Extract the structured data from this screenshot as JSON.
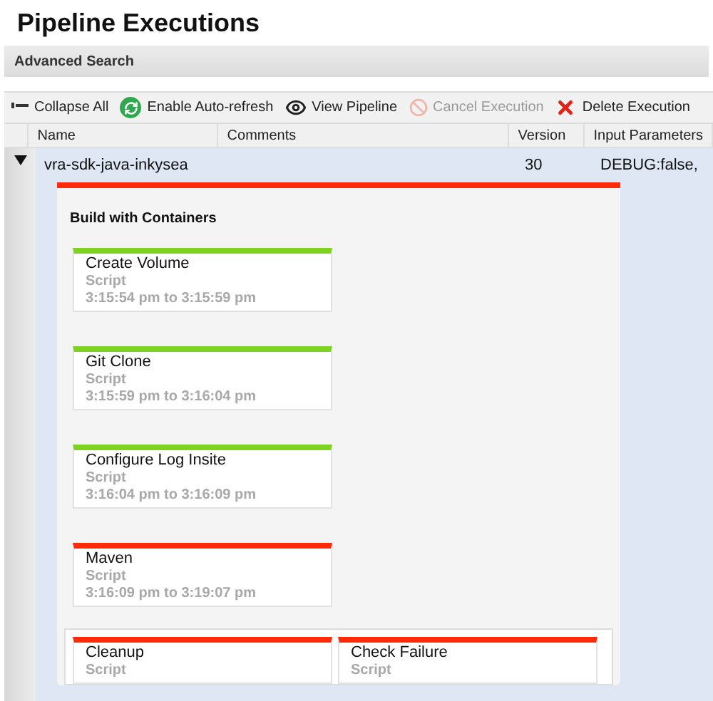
{
  "title": "Pipeline Executions",
  "advanced_search": {
    "label": "Advanced Search"
  },
  "toolbar": [
    {
      "kind": "collapse",
      "label": "Collapse All",
      "disabled": false
    },
    {
      "kind": "refresh",
      "label": "Enable Auto-refresh",
      "disabled": false
    },
    {
      "kind": "view",
      "label": "View Pipeline",
      "disabled": false
    },
    {
      "kind": "cancel",
      "label": "Cancel Execution",
      "disabled": true
    },
    {
      "kind": "delete",
      "label": "Delete Execution",
      "disabled": false
    }
  ],
  "table": {
    "columns": [
      "Name",
      "Comments",
      "Version",
      "Input Parameters"
    ],
    "rows": [
      {
        "expanded": true,
        "selected": true,
        "cells": [
          "vra-sdk-java-inkysea",
          "",
          "30",
          "DEBUG:false,"
        ]
      }
    ]
  },
  "detail": {
    "title": "Build with Containers",
    "color": "#ff2a0a",
    "stages": [
      {
        "name": "Create Volume",
        "type": "Script",
        "time": "3:15:54 pm to 3:15:59 pm",
        "color": "#7ed321"
      },
      {
        "name": "Git Clone",
        "type": "Script",
        "time": "3:15:59 pm to 3:16:04 pm",
        "color": "#7ed321"
      },
      {
        "name": "Configure Log Insite",
        "type": "Script",
        "time": "3:16:04 pm to 3:16:09 pm",
        "color": "#7ed321"
      },
      {
        "name": "Maven",
        "type": "Script",
        "time": "3:16:09 pm to 3:19:07 pm",
        "color": "#ff2a0a"
      }
    ],
    "parallel": [
      {
        "name": "Cleanup",
        "type": "Script",
        "color": "#ff2a0a"
      },
      {
        "name": "Check Failure",
        "type": "Script",
        "color": "#ff2a0a"
      }
    ]
  }
}
